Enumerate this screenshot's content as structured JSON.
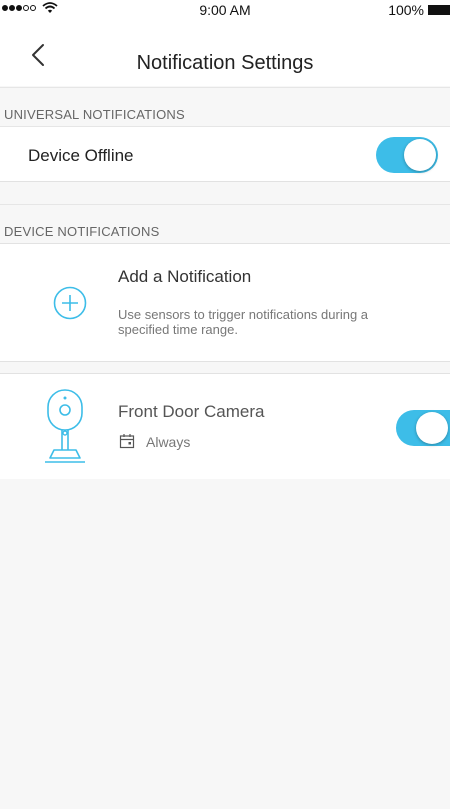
{
  "status_bar": {
    "time": "9:00 AM",
    "battery": "100%",
    "signal_icon": "signal-dots-icon",
    "wifi_icon": "wifi-icon",
    "battery_icon": "battery-icon"
  },
  "nav": {
    "title": "Notification Settings",
    "back_icon": "chevron-left-icon"
  },
  "universal": {
    "header": "UNIVERSAL NOTIFICATIONS",
    "items": [
      {
        "label": "Device Offline",
        "enabled": true
      }
    ]
  },
  "device": {
    "header": "DEVICE NOTIFICATIONS",
    "add": {
      "title": "Add a Notification",
      "description": "Use sensors to trigger notifications during a specified time range.",
      "icon": "plus-circle-icon"
    },
    "items": [
      {
        "name": "Front Door Camera",
        "schedule": "Always",
        "enabled": true,
        "icon": "camera-icon",
        "schedule_icon": "calendar-icon"
      }
    ]
  },
  "colors": {
    "accent": "#3dbde8",
    "background": "#f7f7f7"
  }
}
